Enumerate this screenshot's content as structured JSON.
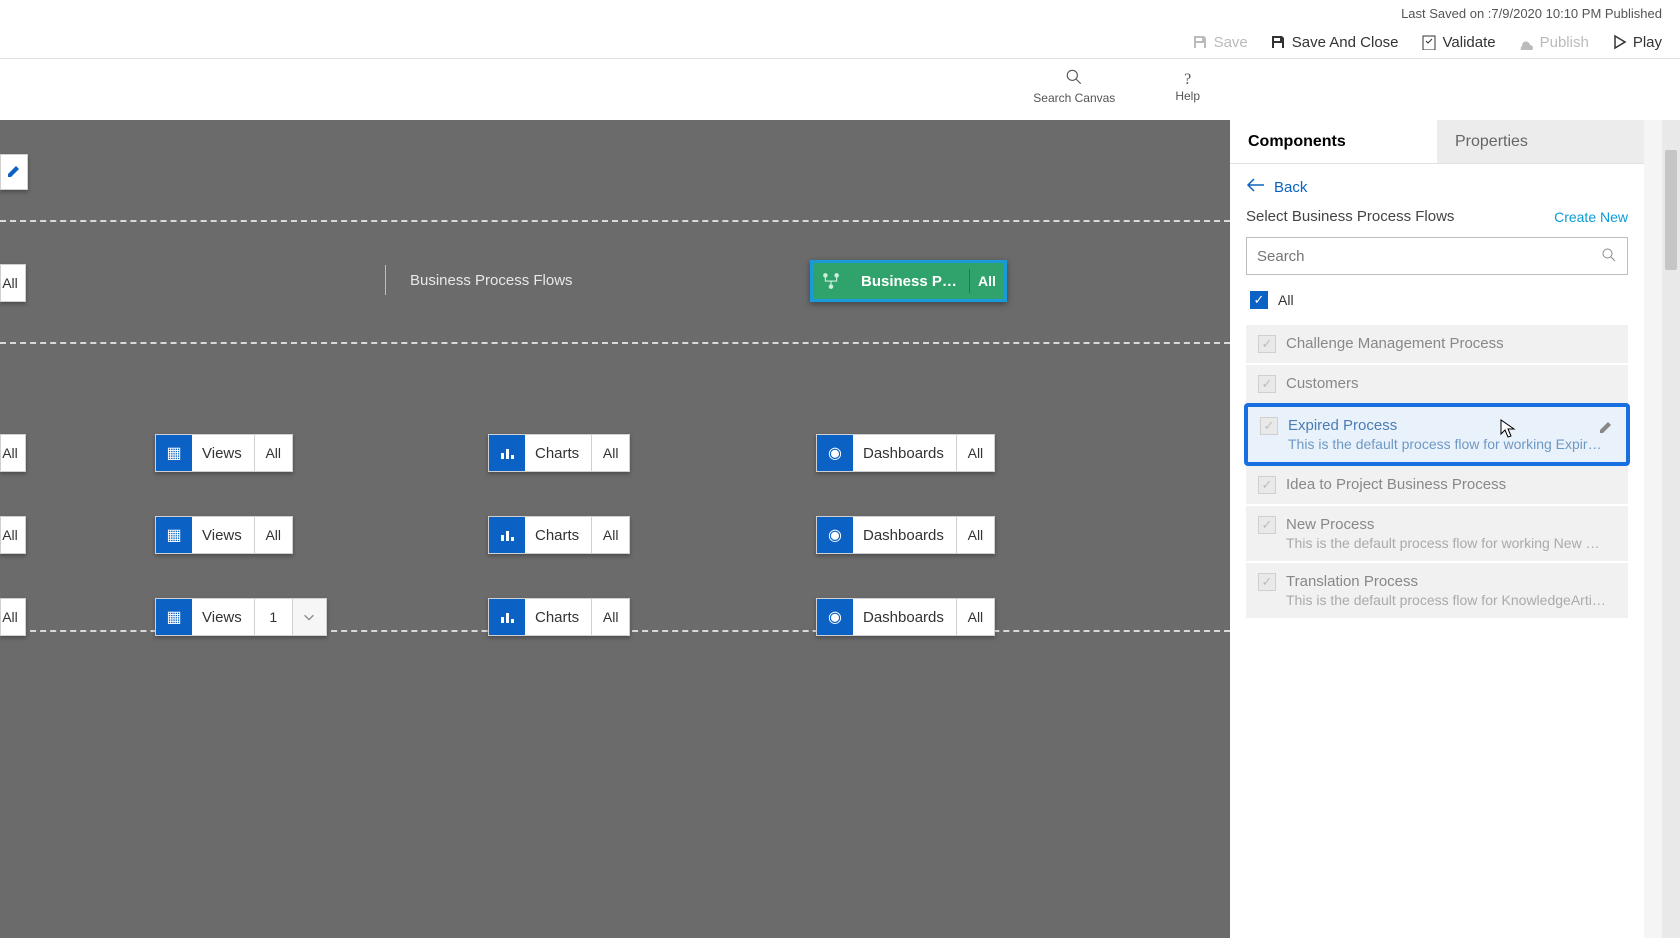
{
  "status": {
    "text": "Last Saved on :7/9/2020 10:10 PM Published"
  },
  "commands": {
    "save": "Save",
    "save_close": "Save And Close",
    "validate": "Validate",
    "publish": "Publish",
    "play": "Play"
  },
  "toolbar": {
    "search": "Search Canvas",
    "help": "Help"
  },
  "panel": {
    "tab_components": "Components",
    "tab_properties": "Properties",
    "back": "Back",
    "select_title": "Select Business Process Flows",
    "create_new": "Create New",
    "search_placeholder": "Search",
    "all_label": "All",
    "processes": [
      {
        "name": "Challenge Management Process",
        "desc": ""
      },
      {
        "name": "Customers",
        "desc": ""
      },
      {
        "name": "Expired Process",
        "desc": "This is the default process flow for working Expired K…",
        "highlight": true
      },
      {
        "name": "Idea to Project Business Process",
        "desc": ""
      },
      {
        "name": "New Process",
        "desc": "This is the default process flow for working New Kno…"
      },
      {
        "name": "Translation Process",
        "desc": "This is the default process flow for KnowledgeArticle …"
      }
    ]
  },
  "canvas": {
    "section_label": "Business Process Flows",
    "selected_pill": {
      "label": "Business Proces…",
      "badge": "All"
    },
    "labels": {
      "views": "Views",
      "charts": "Charts",
      "dashboards": "Dashboards",
      "all": "All",
      "one": "1"
    }
  }
}
